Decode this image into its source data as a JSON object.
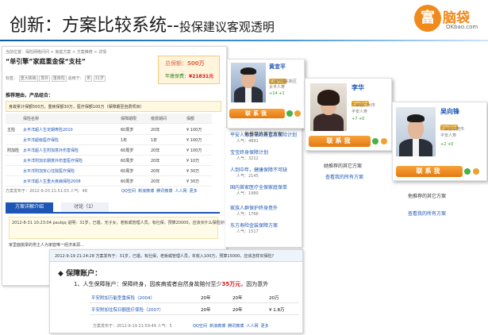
{
  "headline": {
    "main": "创新：方案比较系统",
    "dash": "--",
    "sub": "投保建议客观透明"
  },
  "logo": {
    "mark": "富",
    "name": "脑袋",
    "sub": "OKbao.com"
  },
  "plan_page": {
    "breadcrumb": "当前位置：保险网络问问 > 家庭方案 > 方案推荐 > 详情",
    "title": "“单引擎”家庭重金保“支柱”",
    "premium_label": "总保额：",
    "premium_value": "500万",
    "annual_label": "年缴保费：",
    "annual_value": "¥21831元",
    "tags_label": "标签：",
    "tags": [
      "重大疾病",
      "意外",
      "重疾险"
    ],
    "applicant_label": "适用于：",
    "applicant": [
      "男",
      "31岁"
    ],
    "section_title": "推荐理由，产品组合：",
    "summary": "身故累计保额500万，重疾保额30万，医疗保额100万（保障期至自费项目）",
    "columns": [
      "",
      "保险名称",
      "保障期限",
      "缴费期间",
      "保额"
    ],
    "rows": [
      [
        "主险",
        "太平洋超人生定期寿险2010",
        "60周岁",
        "20年",
        "¥ 100万"
      ],
      [
        "",
        "太平洋超级医疗保险",
        "1年",
        "1年",
        "¥ 100万"
      ],
      [
        "附加险",
        "太平洋超人生附加意外伤害保险",
        "60周岁",
        "20年",
        "¥ 100万"
      ],
      [
        "",
        "太平洋附加长期意外伤害医疗保险",
        "60周岁",
        "20年",
        "¥ 10万"
      ],
      [
        "",
        "太平洋附加安心住院医疗保险",
        "60周岁",
        "20年",
        "¥ 30万"
      ],
      [
        "",
        "太平洋超人生重大疾病保险2008",
        "60周岁",
        "20年",
        "¥ 30万"
      ]
    ],
    "footer": "方案发布于：2012-9-20 21:51:03  人气：48",
    "tab_detail": "方案详解介绍",
    "tab_discuss": "讨论（1）",
    "comment_meta": "2012-8-31 10:23:04 paulqq 说明：31岁，已婚，无子女，老板或管理人员，有社保，预算20000，应该买什么保险好？",
    "comment_body": "家里面挑梁的男主人为家庭唯一经济来源..."
  },
  "share": {
    "items": [
      "QQ空间",
      "新浪微博",
      "腾讯微博",
      "人人网",
      "更多"
    ]
  },
  "overlay": {
    "meta": "2012-9-19 21:24:28 方案发布于：31岁，已婚，有社保，老板或管理人员，年收入100万，预算15000，应该怎样买保险?",
    "heading": "保障账户：",
    "item": "1、人生保障账户：保障终身，因疾病或者自然身故赔付至少",
    "item_amount": "35万元",
    "item_tail": "，因为意外",
    "rows": [
      [
        "平安附加万能型重疾险（2004）",
        "20年",
        "20年",
        "20万"
      ],
      [
        "平安附加住院日额医疗保险（2007）",
        "20年",
        "20年",
        "¥ 1.8万"
      ]
    ],
    "footer": "方案发布于：2012-9-19 21:59:49  人气：5"
  },
  "middle_links": [
    {
      "text": "平安人寿金诺终身重疾保险计划",
      "sub": "人气：4891"
    },
    {
      "text": "宝宝终身保障计划",
      "sub": "人气：3212"
    },
    {
      "text": "人到中年，健康保障不可缺",
      "sub": "人气：2145"
    },
    {
      "text": "国内首家医疗全保家庭保单",
      "sub": "人气：1980"
    },
    {
      "text": "家族人群保护终身意外",
      "sub": "人气：1766"
    },
    {
      "text": "东方寿险金装保障方案",
      "sub": "人气：1517"
    }
  ],
  "agents": [
    {
      "name": "黄宜平",
      "vip": "VIP认证",
      "city": "上海市浦东新区",
      "company": "太平人寿",
      "score": "+14 +1",
      "button": "联系我",
      "other_label": "他推荐的其它方案"
    },
    {
      "name": "李华",
      "vip": "VIP认证",
      "city": "广东省广州市",
      "company": "平安人寿",
      "score": "+7 +0",
      "button": "联系我",
      "other_label": "她推荐的其它方案",
      "all_label": "查看我的所有方案"
    },
    {
      "name": "吴向锋",
      "vip": "VIP认证",
      "city": "广东省东莞市",
      "company": "平安人寿",
      "score": "+2 +0",
      "button": "联系我",
      "other_label": "他推荐的其它方案",
      "all_label": "查看我的所有方案"
    }
  ],
  "colors": {
    "accent": "#f08a1c",
    "link": "#1d56b5",
    "button": "#e37a10"
  }
}
